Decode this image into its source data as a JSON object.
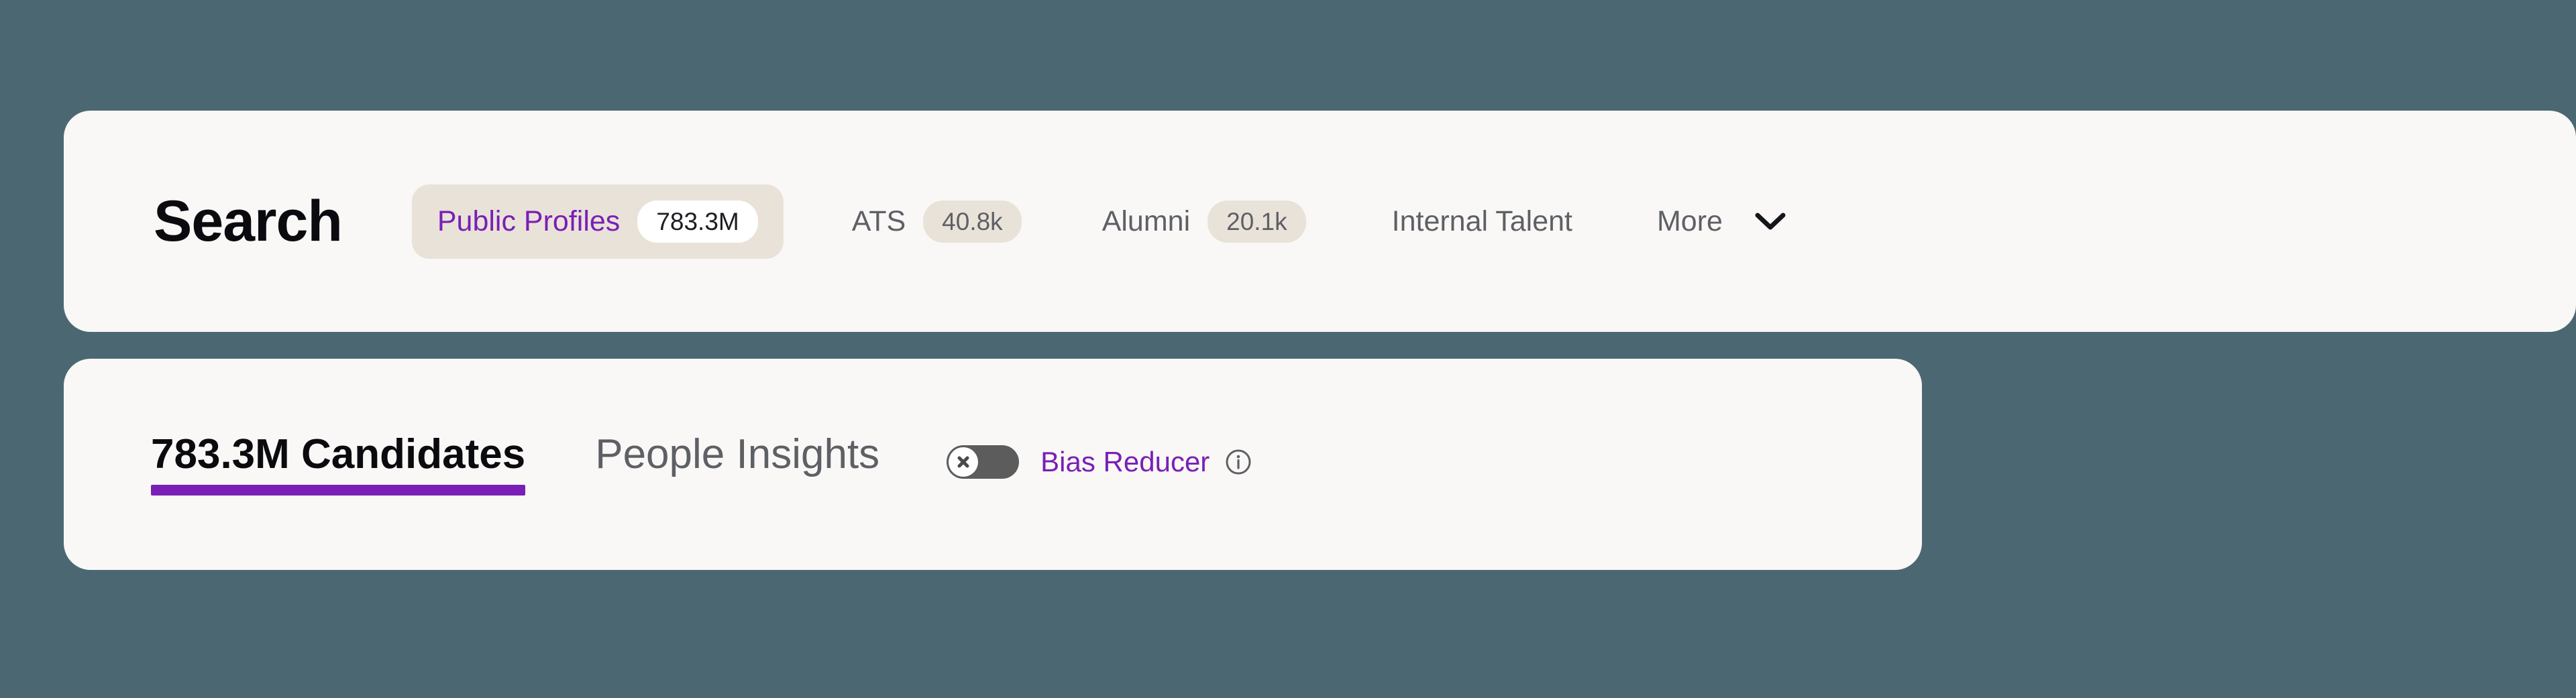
{
  "page": {
    "background_color": "#4b6872",
    "card_background": "#f9f8f6",
    "accent_purple": "#7a1fb5",
    "beige_pill": "#e9e2d9",
    "muted_text": "#5e6065"
  },
  "header": {
    "title": "Search",
    "source_tabs": [
      {
        "label": "Public Profiles",
        "count": "783.3M",
        "active": true
      },
      {
        "label": "ATS",
        "count": "40.8k",
        "active": false
      },
      {
        "label": "Alumni",
        "count": "20.1k",
        "active": false
      },
      {
        "label": "Internal Talent",
        "count": "",
        "active": false
      },
      {
        "label": "More",
        "count": "",
        "active": false
      }
    ],
    "more_label": "More",
    "more_icon": "chevron-down-icon"
  },
  "results": {
    "tabs": [
      {
        "label": "783.3M Candidates",
        "active": true
      },
      {
        "label": "People Insights",
        "active": false
      }
    ],
    "bias_reducer": {
      "label": "Bias Reducer",
      "state": "off",
      "knob_icon": "x-mark-icon",
      "info_icon": "info-circle-icon"
    }
  }
}
